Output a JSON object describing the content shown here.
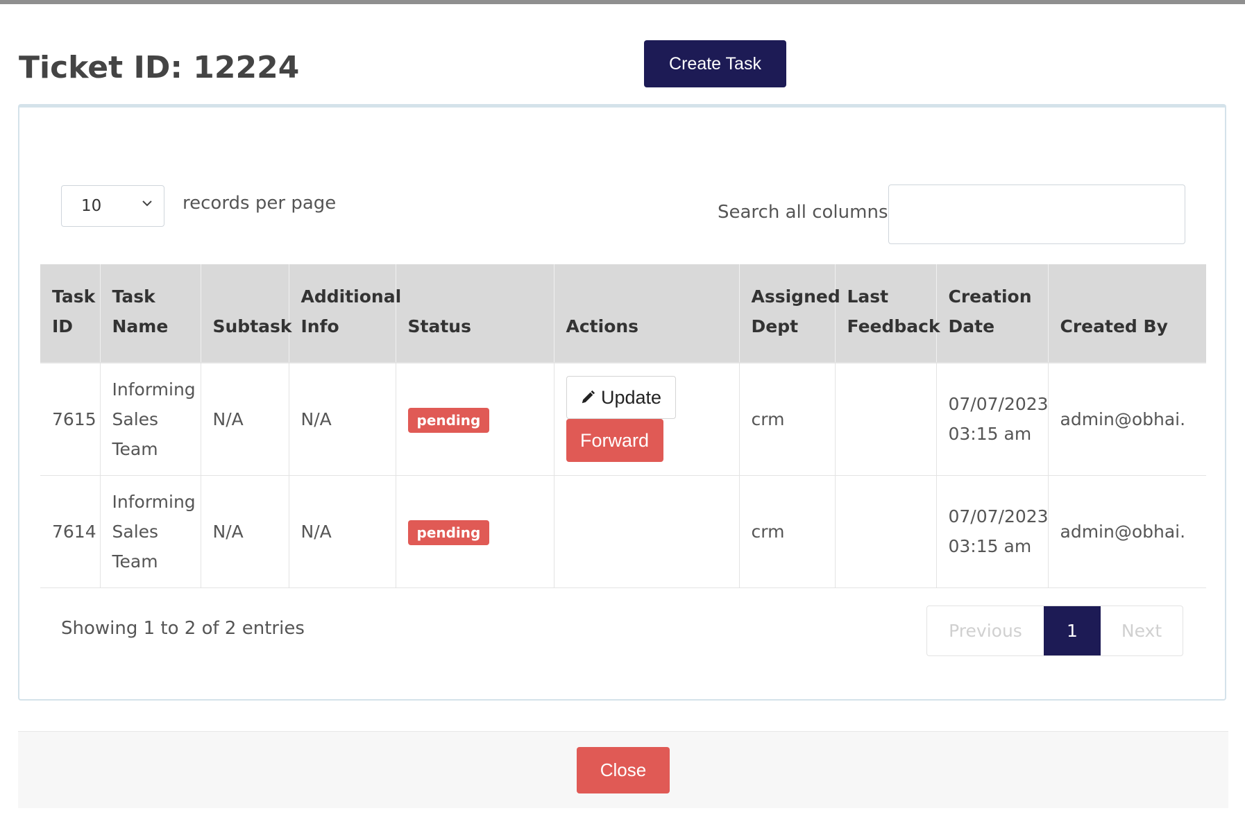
{
  "modal": {
    "title": "Ticket ID: 12224",
    "create_task_label": "Create Task",
    "close_label": "Close"
  },
  "table_controls": {
    "page_length_value": "10",
    "page_length_label": "records per page",
    "search_label": "Search all columns:",
    "search_value": ""
  },
  "table": {
    "headers": {
      "task_id": "Task ID",
      "task_name": "Task Name",
      "subtask": "Subtask",
      "additional_info": "Additional Info",
      "status": "Status",
      "actions": "Actions",
      "assigned_dept": "Assigned Dept",
      "last_feedback": "Last Feedback",
      "creation_date": "Creation Date",
      "created_by": "Created By"
    },
    "rows": [
      {
        "task_id": "7615",
        "task_name": "Informing Sales Team",
        "subtask": "N/A",
        "additional_info": "N/A",
        "status": "pending",
        "update_label": "Update",
        "forward_label": "Forward",
        "assigned_dept": "crm",
        "last_feedback": "",
        "creation_date": "07/07/2023 03:15 am",
        "created_by": "admin@obhai."
      },
      {
        "task_id": "7614",
        "task_name": "Informing Sales Team",
        "subtask": "N/A",
        "additional_info": "N/A",
        "status": "pending",
        "assigned_dept": "crm",
        "last_feedback": "",
        "creation_date": "07/07/2023 03:15 am",
        "created_by": "admin@obhai."
      }
    ]
  },
  "table_footer": {
    "info": "Showing 1 to 2 of 2 entries",
    "previous_label": "Previous",
    "current_page": "1",
    "next_label": "Next"
  },
  "icons": {
    "update": "pencil-icon",
    "select": "chevron-down-icon"
  },
  "colors": {
    "primary": "#1d1b55",
    "danger": "#e05a55",
    "header_bg": "#d9d9d9"
  }
}
